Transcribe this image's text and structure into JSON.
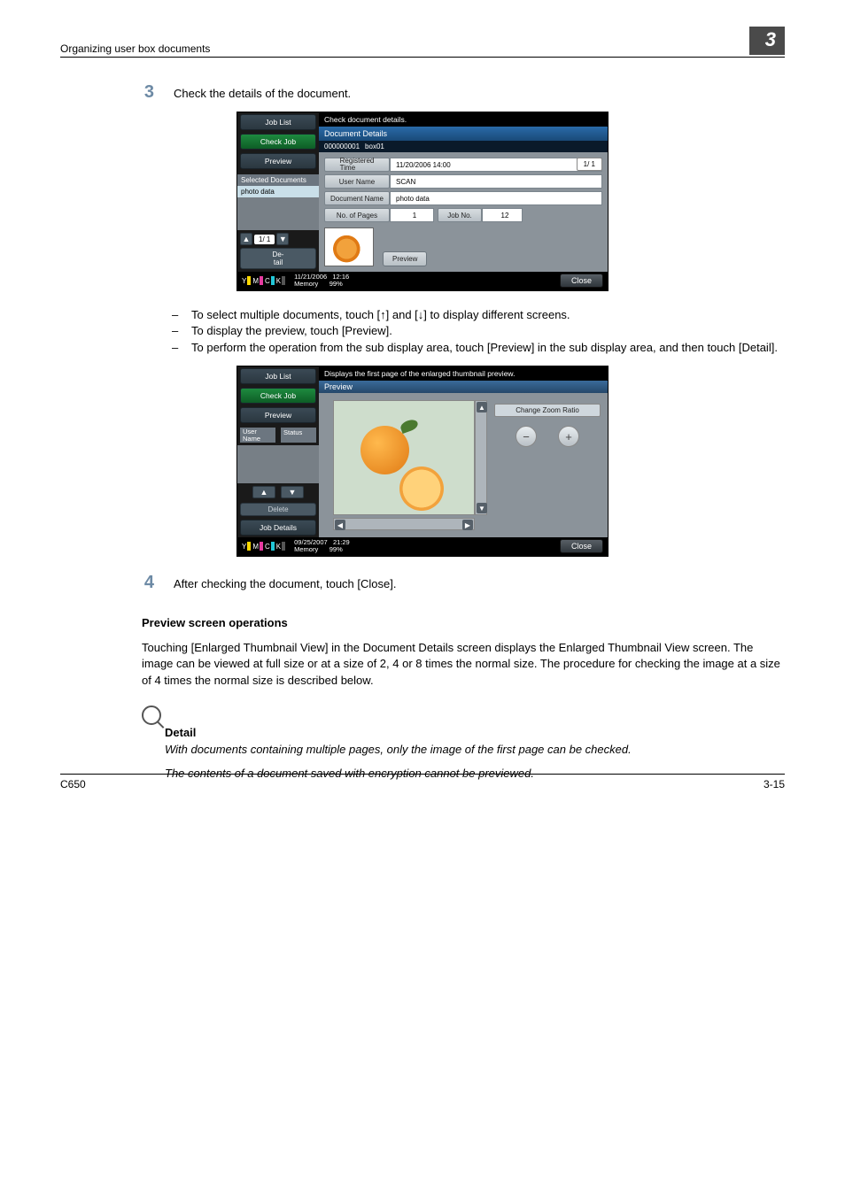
{
  "header": {
    "title": "Organizing user box documents",
    "chapter": "3"
  },
  "steps": {
    "s3": {
      "num": "3",
      "text": "Check the details of the document."
    },
    "s4": {
      "num": "4",
      "text": "After checking the document, touch [Close]."
    }
  },
  "bullets": {
    "b1": "To select multiple documents, touch [↑] and [↓] to display different screens.",
    "b2": "To display the preview, touch [Preview].",
    "b3": "To perform the operation from the sub display area, touch [Preview] in the sub display area, and then touch [Detail]."
  },
  "section_heading": "Preview screen operations",
  "body_para": "Touching [Enlarged Thumbnail View] in the Document Details screen displays the Enlarged Thumbnail View screen. The image can be viewed at full size or at a size of 2, 4 or 8 times the normal size. The procedure for checking the image at a size of 4 times the normal size is described below.",
  "detail": {
    "title": "Detail",
    "line1": "With documents containing multiple pages, only the image of the first page can be checked.",
    "line2": "The contents of a document saved with encryption cannot be previewed."
  },
  "footer": {
    "left": "C650",
    "right": "3-15"
  },
  "panel1": {
    "left": {
      "tabs": {
        "joblist": "Job List",
        "checkjob": "Check Job",
        "preview": "Preview"
      },
      "section": "Selected Documents",
      "doc": "photo data",
      "page": "1/  1",
      "detail": "De-\ntail"
    },
    "title": "Check document details.",
    "subtitle": "Document Details",
    "sub_id": "000000001",
    "sub_name": "box01",
    "rows": {
      "regtime_l": "Registered\nTime",
      "regtime_v": "11/20/2006 14:00",
      "user_l": "User Name",
      "user_v": "SCAN",
      "docname_l": "Document Name",
      "docname_v": "photo data",
      "pages_l": "No. of Pages",
      "pages_v": "1",
      "jobno_l": "Job No.",
      "jobno_v": "12"
    },
    "preview_btn": "Preview",
    "page_ind": "1/  1",
    "datetime": "11/21/2006",
    "time": "12:16",
    "mem_l": "Memory",
    "mem_v": "99%",
    "close": "Close"
  },
  "panel2": {
    "left": {
      "tabs": {
        "joblist": "Job List",
        "checkjob": "Check Job",
        "preview": "Preview"
      },
      "user_l": "User\nName",
      "status_l": "Status",
      "delete": "Delete",
      "jobdetails": "Job Details"
    },
    "title": "Displays the first page of the enlarged thumbnail preview.",
    "preview_tab": "Preview",
    "zoom_label": "Change Zoom Ratio",
    "minus": "−",
    "plus": "+",
    "datetime": "09/25/2007",
    "time": "21:29",
    "mem_l": "Memory",
    "mem_v": "99%",
    "close": "Close"
  }
}
